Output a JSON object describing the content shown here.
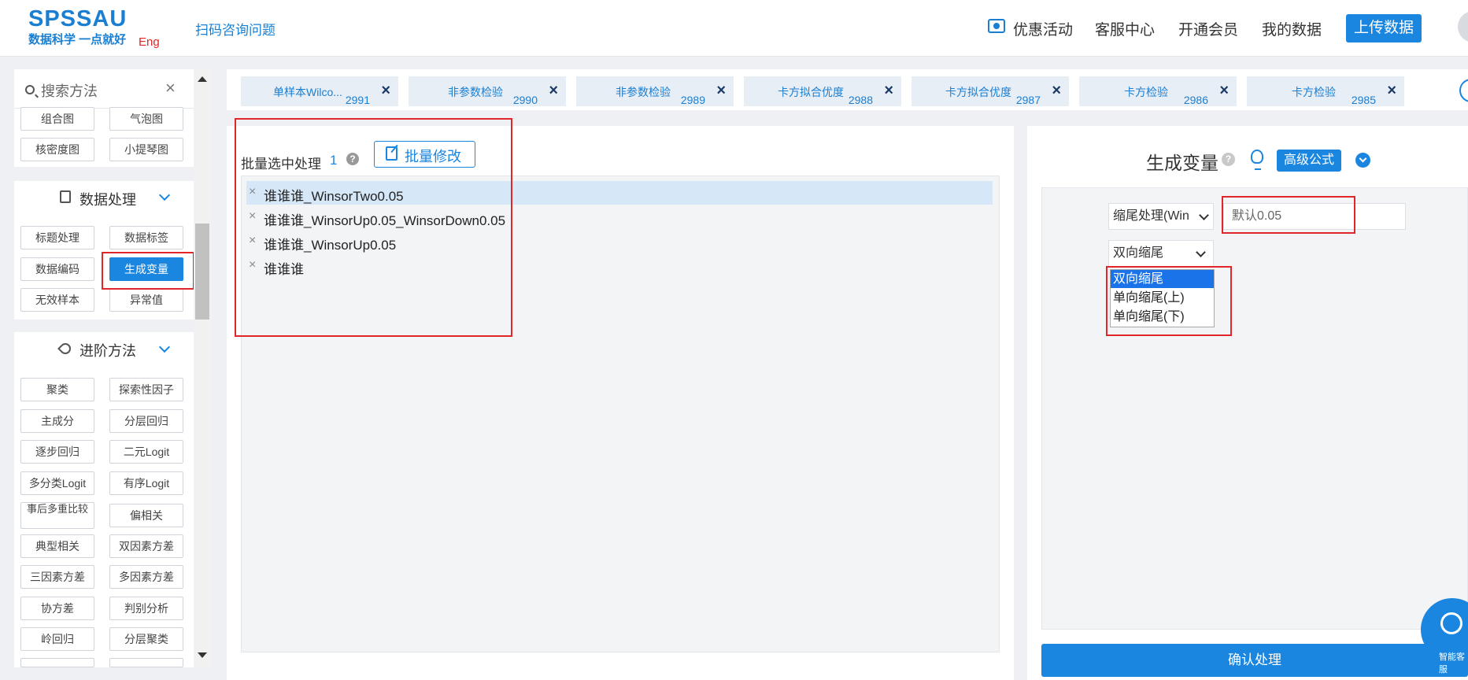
{
  "header": {
    "logo_main": "SPSSAU",
    "logo_sub": "数据科学 一点就好",
    "logo_lang": "Eng",
    "scan_link": "扫码咨询问题",
    "nav": [
      "优惠活动",
      "客服中心",
      "开通会员",
      "我的数据"
    ],
    "upload_label": "上传数据"
  },
  "sidebar": {
    "search_placeholder": "搜索方法",
    "clear_glyph": "×",
    "charts_row1": [
      "组合图",
      "气泡图"
    ],
    "charts_row2": [
      "核密度图",
      "小提琴图"
    ],
    "data_processing": {
      "title": "数据处理",
      "items": [
        "标题处理",
        "数据标签",
        "数据编码",
        "生成变量",
        "无效样本",
        "异常值"
      ],
      "active": "生成变量"
    },
    "advanced": {
      "title": "进阶方法",
      "items": [
        "聚类",
        "探索性因子",
        "主成分",
        "分层回归",
        "逐步回归",
        "二元Logit",
        "多分类Logit",
        "有序Logit",
        "事后多重比较",
        "偏相关",
        "典型相关",
        "双因素方差",
        "三因素方差",
        "多因素方差",
        "协方差",
        "判别分析",
        "岭回归",
        "分层聚类"
      ]
    }
  },
  "tabs": [
    {
      "label": "单样本Wilco...",
      "num": "2991"
    },
    {
      "label": "非参数检验",
      "num": "2990"
    },
    {
      "label": "非参数检验",
      "num": "2989"
    },
    {
      "label": "卡方拟合优度",
      "num": "2988"
    },
    {
      "label": "卡方拟合优度",
      "num": "2987"
    },
    {
      "label": "卡方检验",
      "num": "2986"
    },
    {
      "label": "卡方检验",
      "num": "2985"
    }
  ],
  "tab_close_glyph": "×",
  "left_panel": {
    "batch_title": "批量选中处理",
    "batch_count": "1",
    "help_glyph": "?",
    "batch_edit_label": "批量修改",
    "remove_glyph": "×",
    "variables": [
      "谁谁谁_WinsorTwo0.05",
      "谁谁谁_WinsorUp0.05_WinsorDown0.05",
      "谁谁谁_WinsorUp0.05",
      "谁谁谁"
    ]
  },
  "right_panel": {
    "title": "生成变量",
    "help_glyph": "?",
    "advanced_label": "高级公式",
    "method_select": "缩尾处理(Win",
    "value_placeholder": "默认0.05",
    "direction_select": "双向缩尾",
    "direction_options": [
      "双向缩尾",
      "单向缩尾(上)",
      "单向缩尾(下)"
    ],
    "confirm_label": "确认处理"
  },
  "assistant_label": "智能客服",
  "colors": {
    "accent": "#1a86e0",
    "highlight": "#e0262a"
  }
}
